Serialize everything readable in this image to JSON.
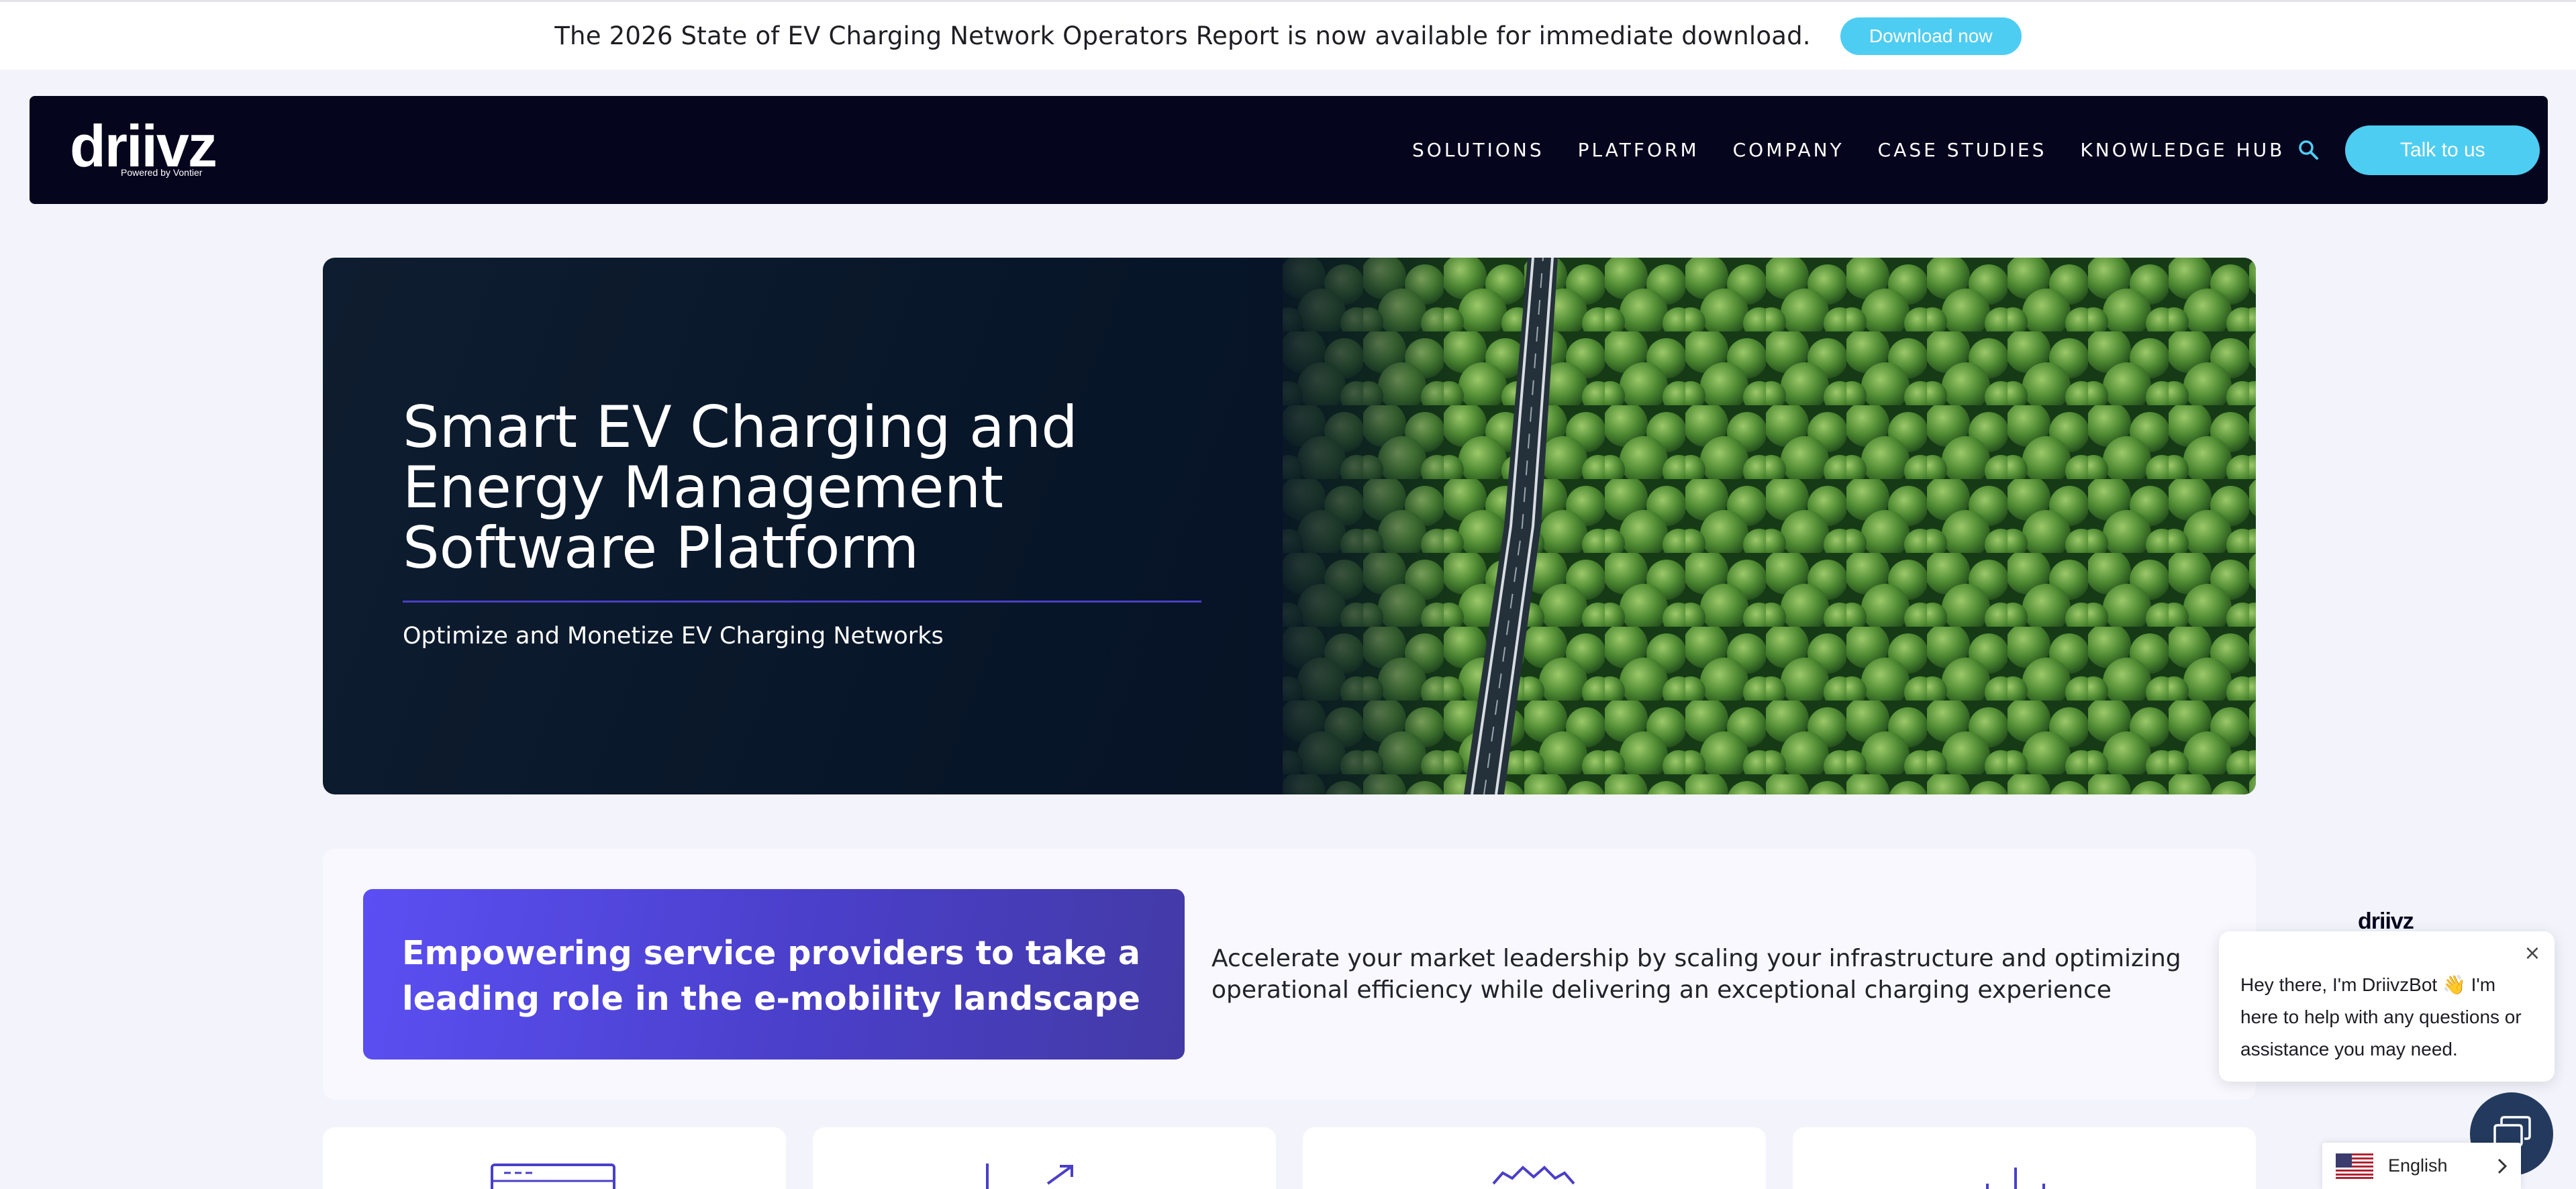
{
  "announcement": {
    "text": "The 2026 State of EV Charging Network Operators Report is now available for immediate download.",
    "button": "Download now"
  },
  "nav": {
    "logo": "driivz",
    "logo_sub": "Powered by Vontier",
    "items": [
      "SOLUTIONS",
      "PLATFORM",
      "COMPANY",
      "CASE STUDIES",
      "KNOWLEDGE HUB"
    ],
    "search_icon": "search-icon",
    "cta": "Talk to us"
  },
  "hero": {
    "title": "Smart EV Charging and Energy Management Software Platform",
    "subtitle": "Optimize and Monetize EV Charging Networks"
  },
  "value": {
    "heading": "Empowering service providers to take a leading role in the e-mobility landscape",
    "description": "Accelerate your market leadership by scaling your infrastructure and optimizing operational efficiency while delivering an exceptional charging experience"
  },
  "features": [
    {
      "icon": "browser-window-icon"
    },
    {
      "icon": "growth-chart-icon"
    },
    {
      "icon": "badge-icon"
    },
    {
      "icon": "bar-chart-icon"
    }
  ],
  "chat": {
    "logo": "driivz",
    "message": "Hey there, I'm DriivzBot 👋 I'm here to help with any questions or assistance you may need.",
    "close": "×"
  },
  "language": {
    "label": "English",
    "flag": "us-flag-icon"
  },
  "colors": {
    "accent": "#4ecdf2",
    "navy": "#05051e",
    "purple": "#5b4ff3"
  }
}
